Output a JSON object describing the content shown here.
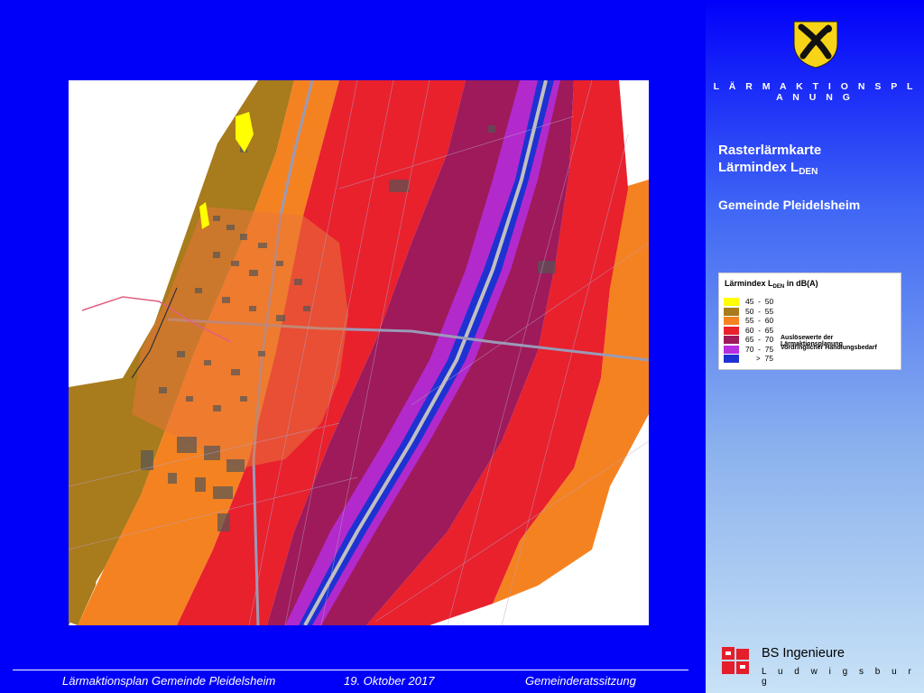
{
  "sidebar": {
    "section_title": "L Ä R M A K T I O N S P L A N U N G",
    "map_title_line1": "Rasterlärmkarte",
    "map_title_line2_main": "Lärmindex  L",
    "map_title_line2_sub": "DEN",
    "municipality": "Gemeinde Pleidelsheim",
    "crest_icon": "municipal-crest-icon",
    "legend": {
      "title_main": "Lärmindex L",
      "title_sub": "DEN",
      "title_suffix": " in dB(A)",
      "classes": [
        {
          "range": "45  -  50",
          "color": "#ffff00",
          "note": ""
        },
        {
          "range": "50  -  55",
          "color": "#a87b1c",
          "note": ""
        },
        {
          "range": "55  -  60",
          "color": "#f58220",
          "note": ""
        },
        {
          "range": "60  -  65",
          "color": "#e8212d",
          "note": ""
        },
        {
          "range": "65  -  70",
          "color": "#9e1a5a",
          "note": "Auslösewerte der Lärmaktionsplanung"
        },
        {
          "range": "70  -  75",
          "color": "#b52ee0",
          "note": "Vordringlicher Handlungsbedarf"
        },
        {
          "range": "     >  75",
          "color": "#1e32d2",
          "note": ""
        }
      ]
    },
    "company": {
      "name": "BS Ingenieure",
      "city": "L u d w i g s b u r g",
      "logo_icon": "bs-logo-icon"
    }
  },
  "footer": {
    "plan": "Lärmaktionsplan Gemeinde Pleidelsheim",
    "date": "19. Oktober 2017",
    "meeting": "Gemeinderatssitzung"
  }
}
